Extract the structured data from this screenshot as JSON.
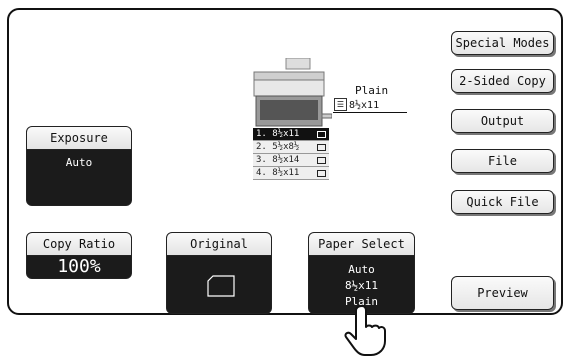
{
  "right_buttons": {
    "special_modes": "Special Modes",
    "two_sided_copy": "2-Sided Copy",
    "output": "Output",
    "file": "File",
    "quick_file": "Quick File",
    "preview": "Preview"
  },
  "exposure": {
    "label": "Exposure",
    "value": "Auto"
  },
  "copy_ratio": {
    "label": "Copy Ratio",
    "value": "100%"
  },
  "original": {
    "label": "Original"
  },
  "paper_select": {
    "label": "Paper Select",
    "line1": "Auto",
    "line2": "8½x11",
    "line3": "Plain"
  },
  "bypass": {
    "type": "Plain",
    "size": "8½x11"
  },
  "trays": [
    {
      "label": "1. 8½x11"
    },
    {
      "label": "2. 5½x8½"
    },
    {
      "label": "3. 8½x14"
    },
    {
      "label": "4. 8½x11"
    }
  ],
  "icons": [
    "paper-feed-icon",
    "original-paper-icon",
    "pointing-hand-icon",
    "tray-icon",
    "bypass-tray-icon"
  ]
}
